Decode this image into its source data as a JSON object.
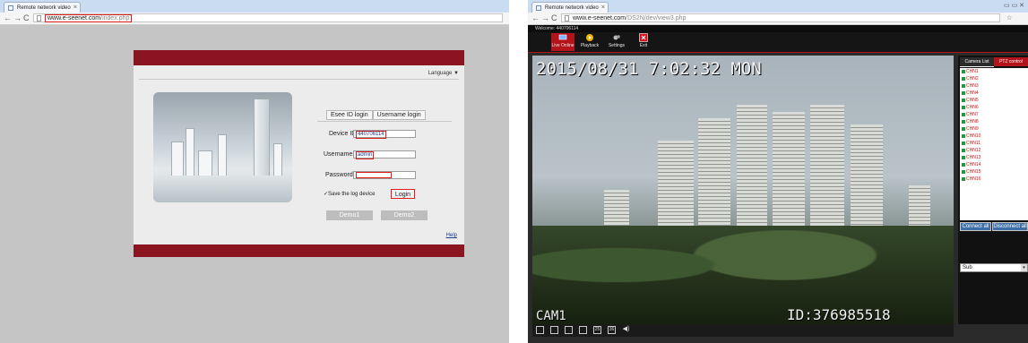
{
  "left": {
    "tab_title": "Remote network video",
    "url_host": "www.e-seenet.com",
    "url_path": "/index.php",
    "language_label": "Language ▼",
    "tabs": [
      "Esee ID login",
      "Username login"
    ],
    "fields": {
      "device_id_label": "Device ID:",
      "device_id_value": "440706114",
      "username_label": "Username:",
      "username_value": "admin",
      "password_label": "Password:"
    },
    "save_log_label": "Save the log device",
    "login_label": "Login",
    "demo1_label": "Demo1",
    "demo2_label": "Demo2",
    "help_label": "Help"
  },
  "right": {
    "tab_title": "Remote network video",
    "url_host": "www.e-seenet.com",
    "url_path": "/DS2N/dev/view3.php",
    "welcome": "Welcome: 440706114",
    "toolbar": [
      "Live Online",
      "Playback",
      "Settings",
      "Exit"
    ],
    "osd_datetime": "2015/08/31 7:02:32 MON",
    "osd_cam": "CAM1",
    "osd_id": "ID:376985518",
    "layout_buttons": [
      "",
      "",
      "",
      "",
      "25",
      "36"
    ],
    "side_tabs": [
      "Camera List",
      "PTZ control"
    ],
    "channels": [
      "CHN1",
      "CHN2",
      "CHN3",
      "CHN4",
      "CHN5",
      "CHN6",
      "CHN7",
      "CHN8",
      "CHN9",
      "CHN10",
      "CHN11",
      "CHN12",
      "CHN13",
      "CHN14",
      "CHN15",
      "CHN16"
    ],
    "connect_all": "Connect all",
    "disconnect_all": "Disconnect all",
    "stream_value": "Sub"
  },
  "colors": {
    "accent_red": "#b3131b",
    "highlight_red": "#e01d1d",
    "login_bar": "#8a1420"
  }
}
